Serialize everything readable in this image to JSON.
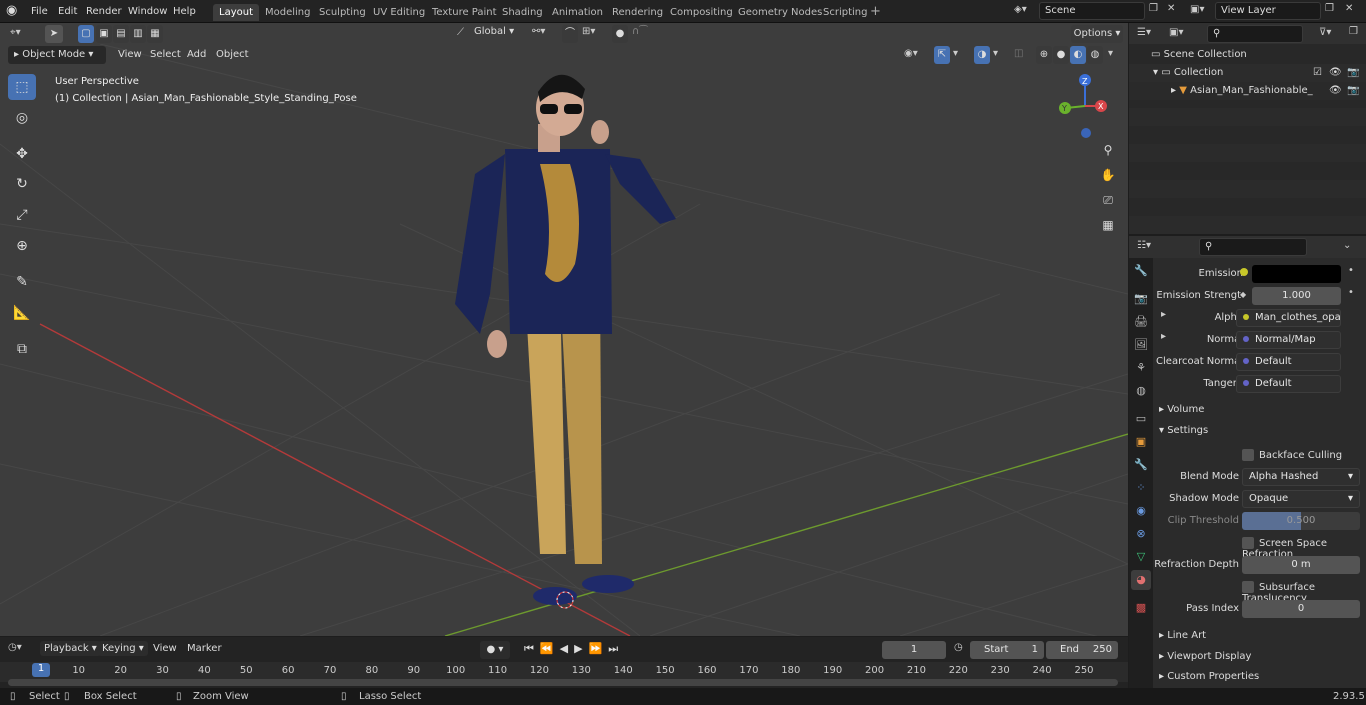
{
  "menus": [
    "File",
    "Edit",
    "Render",
    "Window",
    "Help"
  ],
  "workspaces": [
    "Layout",
    "Modeling",
    "Sculpting",
    "UV Editing",
    "Texture Paint",
    "Shading",
    "Animation",
    "Rendering",
    "Compositing",
    "Geometry Nodes",
    "Scripting"
  ],
  "scene": "Scene",
  "view_layer": "View Layer",
  "header": {
    "mode": "Object Mode",
    "view": "View",
    "select": "Select",
    "add": "Add",
    "object": "Object",
    "transform": "Global",
    "options": "Options"
  },
  "viewport": {
    "perspective": "User Perspective",
    "collection_info": "(1) Collection | Asian_Man_Fashionable_Style_Standing_Pose",
    "axis_x": "X",
    "axis_y": "Y",
    "axis_z": "Z"
  },
  "outliner": {
    "scene_collection": "Scene Collection",
    "collection": "Collection",
    "object": "Asian_Man_Fashionable_"
  },
  "props": {
    "emission": "Emission",
    "emission_strength_label": "Emission Strengt",
    "emission_strength": "1.000",
    "alpha_label": "Alpha",
    "alpha": "Man_clothes_opacit...",
    "normal_label": "Normal",
    "normal": "Normal/Map",
    "clearcoat_label": "Clearcoat Normal",
    "clearcoat": "Default",
    "tangent_label": "Tangent",
    "tangent": "Default",
    "volume": "Volume",
    "settings": "Settings",
    "backface": "Backface Culling",
    "blend_label": "Blend Mode",
    "blend": "Alpha Hashed",
    "shadow_label": "Shadow Mode",
    "shadow": "Opaque",
    "clip_label": "Clip Threshold",
    "clip": "0.500",
    "ssr": "Screen Space Refraction",
    "refr_label": "Refraction Depth",
    "refr": "0 m",
    "sst": "Subsurface Translucency",
    "pass_label": "Pass Index",
    "pass": "0",
    "line_art": "Line Art",
    "viewport_display": "Viewport Display",
    "custom_props": "Custom Properties"
  },
  "timeline": {
    "playback": "Playback",
    "keying": "Keying",
    "view": "View",
    "marker": "Marker",
    "current": "1",
    "start_label": "Start",
    "start": "1",
    "end_label": "End",
    "end": "250",
    "ticks": [
      "1",
      "10",
      "20",
      "30",
      "40",
      "50",
      "60",
      "70",
      "80",
      "90",
      "100",
      "110",
      "120",
      "130",
      "140",
      "150",
      "160",
      "170",
      "180",
      "190",
      "200",
      "210",
      "220",
      "230",
      "240",
      "250"
    ]
  },
  "status": {
    "select": "Select",
    "box": "Box Select",
    "zoom": "Zoom View",
    "lasso": "Lasso Select",
    "version": "2.93.5"
  }
}
